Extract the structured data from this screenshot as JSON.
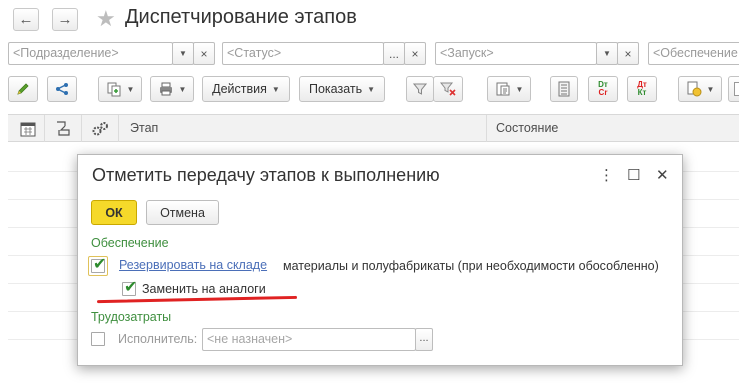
{
  "window": {
    "title": "Диспетчирование этапов",
    "back_icon": "←",
    "forward_icon": "→",
    "star_icon": "★"
  },
  "filters": [
    {
      "placeholder": "<Подразделение>",
      "clear": "×"
    },
    {
      "placeholder": "<Статус>",
      "dots": "...",
      "clear": "×"
    },
    {
      "placeholder": "<Запуск>",
      "clear": "×"
    },
    {
      "placeholder": "<Обеспечение"
    }
  ],
  "toolbar": {
    "actions_label": "Действия",
    "show_label": "Показать",
    "dt_top": "Dт",
    "cr_bottom": "Cr",
    "dt_top2": "Дт",
    "kt_bottom": "Кт"
  },
  "table": {
    "columns": [
      "Этап",
      "Состояние"
    ]
  },
  "dialog": {
    "title": "Отметить передачу этапов к выполнению",
    "menu_icon": "⋮",
    "maximize_icon": "☐",
    "close_icon": "✕",
    "ok_label": "ОК",
    "cancel_label": "Отмена",
    "section_supply": "Обеспечение",
    "reserve_link": "Резервировать на складе",
    "reserve_text": "материалы и полуфабрикаты (при необходимости обособленно)",
    "reserve_checked": true,
    "replace_label": "Заменить на аналоги",
    "replace_checked": true,
    "section_labor": "Трудозатраты",
    "executor_label": "Исполнитель:",
    "executor_placeholder": "<не назначен>",
    "executor_checked": false,
    "dots": "..."
  },
  "colors": {
    "ok_button": "#f5d92a",
    "section_green": "#3f8f3f",
    "link_blue": "#4b6fb8",
    "underline_red": "#e02222"
  }
}
